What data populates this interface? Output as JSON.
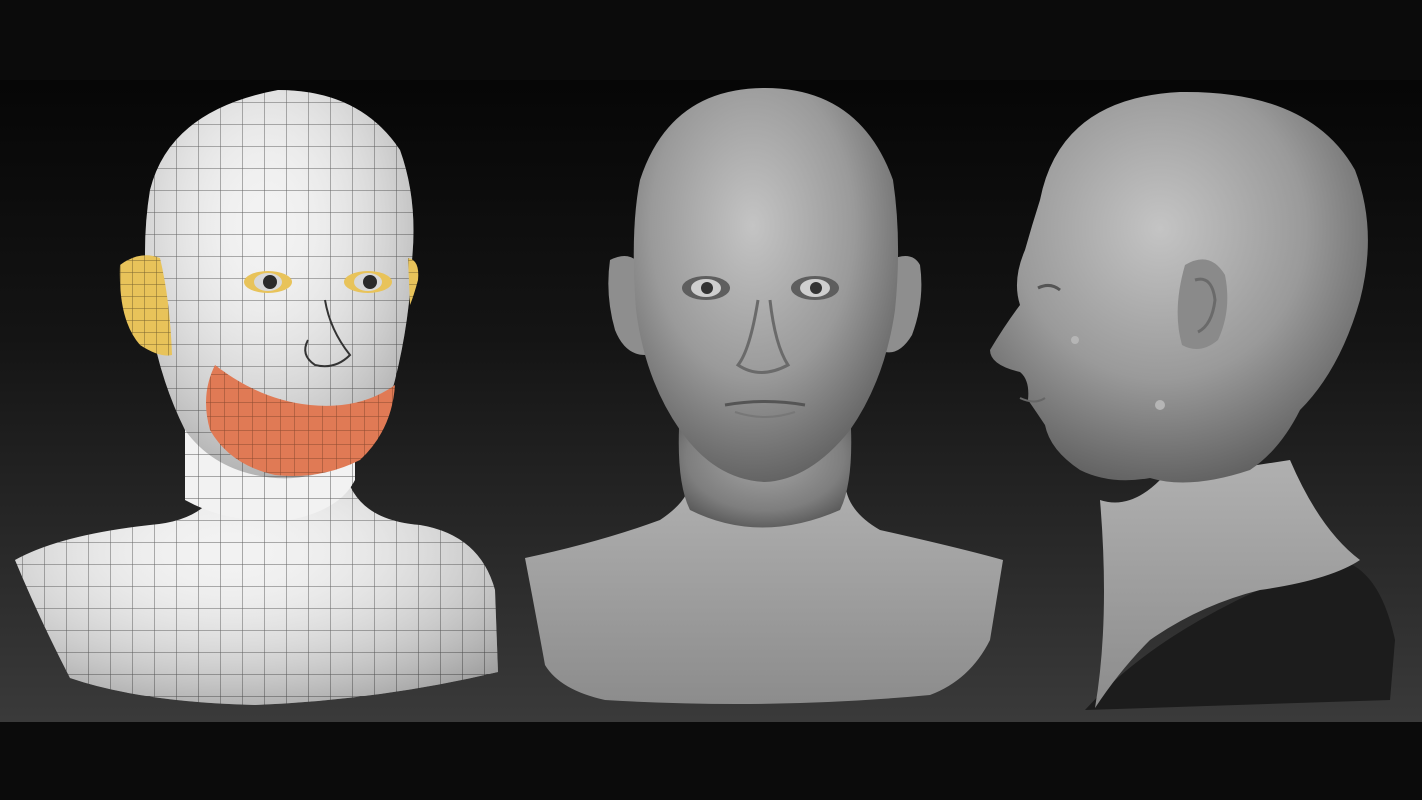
{
  "scene": {
    "figures": [
      {
        "view": "front",
        "shading": "wireframe-topology",
        "highlight_colors": [
          "#e8c35a",
          "#e07a55"
        ]
      },
      {
        "view": "front",
        "shading": "clay-sculpt"
      },
      {
        "view": "profile-left",
        "shading": "clay-sculpt"
      }
    ],
    "colors": {
      "letterbox": "#0b0b0b",
      "background_top": "#060606",
      "background_bottom": "#3a3a3a",
      "wire_base": "#f2f2f2",
      "wire_lines": "#5a5a5a",
      "ear_highlight": "#e8c35a",
      "mouth_highlight": "#e07a55",
      "clay": "#9a9a9a"
    }
  }
}
